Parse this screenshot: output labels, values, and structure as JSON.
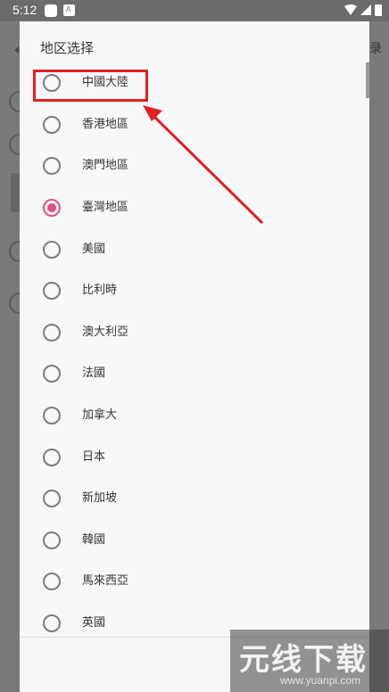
{
  "status_bar": {
    "time": "5:12",
    "notification_icons": [
      "square-app-icon",
      "a-app-icon"
    ],
    "system_icons": [
      "wifi-icon",
      "signal-icon",
      "battery-icon"
    ]
  },
  "background_app": {
    "right_fragment": "录"
  },
  "dialog": {
    "title": "地区选择",
    "selected_index": 3,
    "accent_color": "#e34f82",
    "options": [
      {
        "label": "中國大陸",
        "checked": false
      },
      {
        "label": "香港地區",
        "checked": false
      },
      {
        "label": "澳門地區",
        "checked": false
      },
      {
        "label": "臺灣地區",
        "checked": true
      },
      {
        "label": "美國",
        "checked": false
      },
      {
        "label": "比利時",
        "checked": false
      },
      {
        "label": "澳大利亞",
        "checked": false
      },
      {
        "label": "法國",
        "checked": false
      },
      {
        "label": "加拿大",
        "checked": false
      },
      {
        "label": "日本",
        "checked": false
      },
      {
        "label": "新加坡",
        "checked": false
      },
      {
        "label": "韓國",
        "checked": false
      },
      {
        "label": "馬來西亞",
        "checked": false
      },
      {
        "label": "英國",
        "checked": false
      }
    ]
  },
  "annotation": {
    "color": "#e02020",
    "target": "中國大陸"
  },
  "watermark": {
    "title": "元线下载",
    "url": "www.yuanpi.com"
  }
}
